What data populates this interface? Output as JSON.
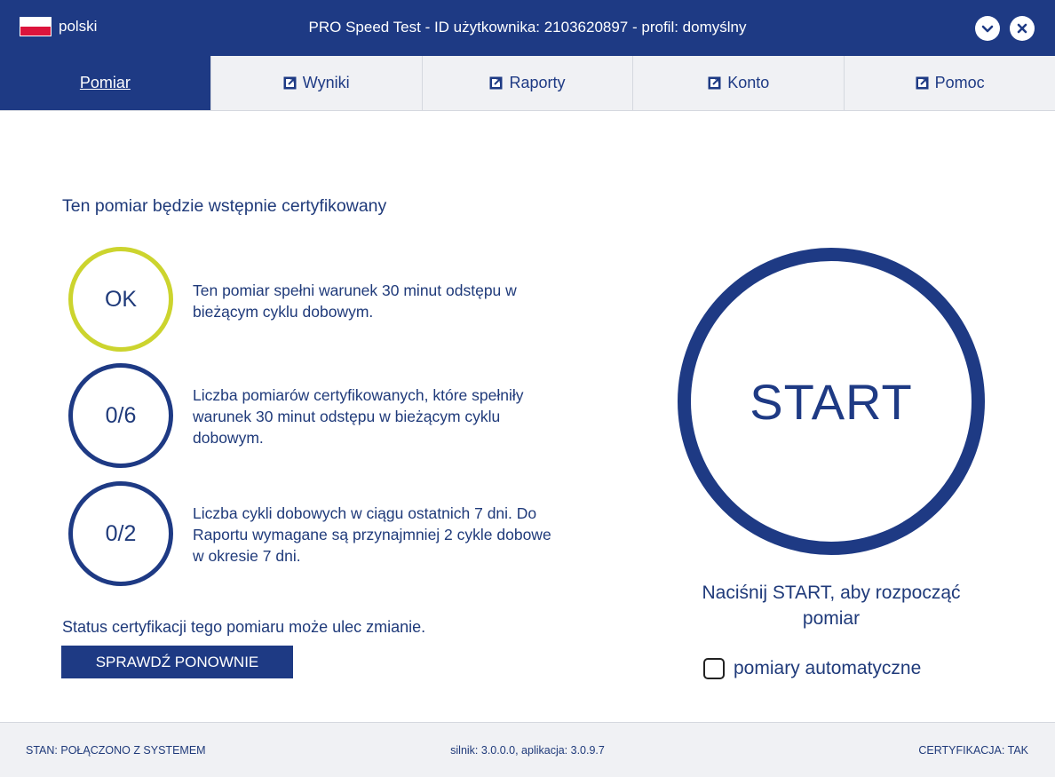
{
  "titlebar": {
    "language": "polski",
    "title": "PRO Speed Test - ID użytkownika: 2103620897 - profil: domyślny",
    "icons": {
      "minimize": "chevron-down-icon",
      "close": "close-icon"
    }
  },
  "tabs": [
    {
      "label": "Pomiar",
      "active": true,
      "icon": ""
    },
    {
      "label": "Wyniki",
      "active": false,
      "icon": "external-link-icon"
    },
    {
      "label": "Raporty",
      "active": false,
      "icon": "external-link-icon"
    },
    {
      "label": "Konto",
      "active": false,
      "icon": "external-link-icon"
    },
    {
      "label": "Pomoc",
      "active": false,
      "icon": "external-link-icon"
    }
  ],
  "main": {
    "heading": "Ten pomiar będzie wstępnie certyfikowany",
    "criteria": [
      {
        "value": "OK",
        "text": "Ten pomiar spełni warunek 30 minut odstępu w bieżącym cyklu dobowym."
      },
      {
        "value": "0/6",
        "text": "Liczba pomiarów certyfikowanych, które spełniły warunek 30 minut odstępu w bieżącym cyklu dobowym."
      },
      {
        "value": "0/2",
        "text": "Liczba cykli dobowych w ciągu ostatnich 7 dni. Do Raportu wymagane są przynajmniej 2 cykle dobowe w okresie 7 dni."
      }
    ],
    "status_note": "Status certyfikacji tego pomiaru może ulec zmianie.",
    "check_again_label": "SPRAWDŹ PONOWNIE",
    "start_label": "START",
    "start_hint": "Naciśnij START, aby rozpocząć pomiar",
    "auto_label": "pomiary automatyczne",
    "auto_checked": false
  },
  "footer": {
    "state": "STAN: POŁĄCZONO Z SYSTEMEM",
    "version": "silnik: 3.0.0.0, aplikacja: 3.0.9.7",
    "certification": "CERTYFIKACJA: TAK"
  },
  "colors": {
    "primary": "#1e3a84",
    "ok_ring": "#ccd42e",
    "flag_red": "#dc143c",
    "background": "#ffffff",
    "tab_bg": "#f0f1f4"
  }
}
